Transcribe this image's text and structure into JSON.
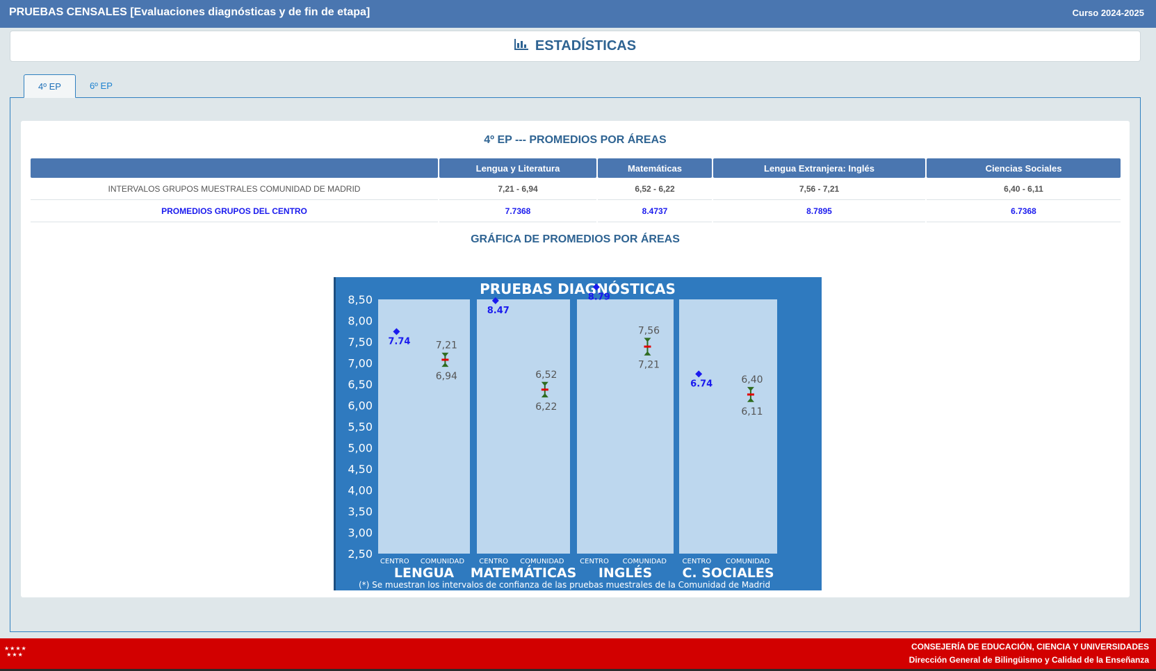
{
  "app": {
    "title": "PRUEBAS CENSALES [Evaluaciones diagnósticas y de fin de etapa]",
    "course": "Curso 2024-2025"
  },
  "header": {
    "icon": "bar-chart-icon",
    "title": "ESTADÍSTICAS"
  },
  "tabs": [
    {
      "label": "4º EP",
      "active": true
    },
    {
      "label": "6º EP",
      "active": false
    }
  ],
  "section": {
    "title": "4º EP --- PROMEDIOS POR ÁREAS",
    "chart_title": "GRÁFICA DE PROMEDIOS POR ÁREAS"
  },
  "table": {
    "headers": [
      "",
      "Lengua y Literatura",
      "Matemáticas",
      "Lengua Extranjera: Inglés",
      "Ciencias Sociales"
    ],
    "rows": [
      {
        "label": "INTERVALOS GRUPOS MUESTRALES COMUNIDAD DE MADRID",
        "values": [
          "7,21 - 6,94",
          "6,52 - 6,22",
          "7,56 - 7,21",
          "6,40 - 6,11"
        ]
      },
      {
        "label": "PROMEDIOS GRUPOS DEL CENTRO",
        "values": [
          "7.7368",
          "8.4737",
          "8.7895",
          "6.7368"
        ]
      }
    ]
  },
  "chart_data": {
    "type": "scatter",
    "title": "PRUEBAS DIAGNÓSTICAS",
    "note": "(*) Se muestran los intervalos de confianza de las pruebas muestrales de la Comunidad de Madrid",
    "ylim": [
      2.5,
      8.5
    ],
    "yticks": [
      "8,50",
      "8,00",
      "7,50",
      "7,00",
      "6,50",
      "6,00",
      "5,50",
      "5,00",
      "4,50",
      "4,00",
      "3,50",
      "3,00",
      "2,50"
    ],
    "groups": [
      {
        "name": "LENGUA",
        "centro": 7.74,
        "centro_label": "7.74",
        "high": 7.21,
        "low": 6.94,
        "high_label": "7,21",
        "low_label": "6,94"
      },
      {
        "name": "MATEMÁTICAS",
        "centro": 8.47,
        "centro_label": "8.47",
        "high": 6.52,
        "low": 6.22,
        "high_label": "6,52",
        "low_label": "6,22"
      },
      {
        "name": "INGLÉS",
        "centro": 8.79,
        "centro_label": "8.79",
        "high": 7.56,
        "low": 7.21,
        "high_label": "7,56",
        "low_label": "7,21"
      },
      {
        "name": "C. SOCIALES",
        "centro": 6.74,
        "centro_label": "6.74",
        "high": 6.4,
        "low": 6.11,
        "high_label": "6,40",
        "low_label": "6,11"
      }
    ],
    "sub_labels": [
      "CENTRO",
      "COMUNIDAD"
    ],
    "colors": {
      "background": "#2f7abf",
      "panel": "#bdd7ee",
      "centro": "#1a1aee",
      "interval": "#2e6b1f",
      "mean": "#e00000"
    }
  },
  "footer": {
    "line1": "CONSEJERÍA DE EDUCACIÓN, CIENCIA Y UNIVERSIDADES",
    "line2": "Dirección General de Bilingüismo y Calidad de la Enseñanza",
    "logo": "stars-logo"
  }
}
